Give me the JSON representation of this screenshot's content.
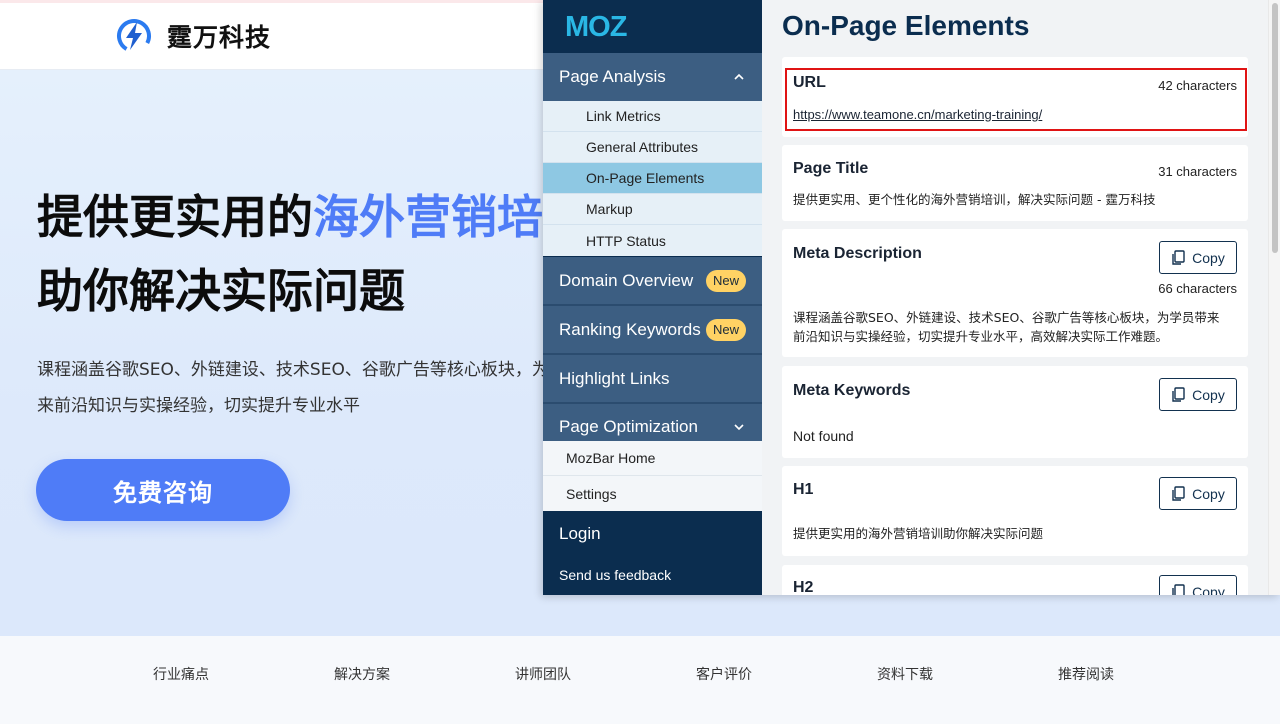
{
  "site": {
    "logo_text": "霆万科技",
    "hero_title_line1_plain": "提供更实用的",
    "hero_title_line1_highlight": "海外营销培训",
    "hero_title_line2": "助你解决实际问题",
    "hero_desc_line1": "课程涵盖谷歌SEO、外链建设、技术SEO、谷歌广告等核心板块，为学员带",
    "hero_desc_line2": "来前沿知识与实操经验，切实提升专业水平",
    "cta_label": "免费咨询",
    "bottom_nav": [
      "行业痛点",
      "解决方案",
      "讲师团队",
      "客户评价",
      "资料下载",
      "推荐阅读"
    ]
  },
  "mozbar": {
    "logo": "MOZ",
    "sidebar": {
      "page_analysis": "Page Analysis",
      "page_analysis_items": [
        "Link Metrics",
        "General Attributes",
        "On-Page Elements",
        "Markup",
        "HTTP Status"
      ],
      "domain_overview": "Domain Overview",
      "ranking_keywords": "Ranking Keywords",
      "new_badge": "New",
      "highlight_links": "Highlight Links",
      "page_optimization": "Page Optimization",
      "lower_items": [
        "MozBar Home",
        "Settings"
      ],
      "login": "Login",
      "feedback": "Send us feedback"
    },
    "main": {
      "title": "On-Page Elements",
      "copy_label": "Copy",
      "url": {
        "label": "URL",
        "count": "42 characters",
        "value": "https://www.teamone.cn/marketing-training/"
      },
      "page_title": {
        "label": "Page Title",
        "count": "31 characters",
        "value": "提供更实用、更个性化的海外营销培训，解决实际问题 - 霆万科技"
      },
      "meta_description": {
        "label": "Meta Description",
        "count": "66 characters",
        "value_line1": "课程涵盖谷歌SEO、外链建设、技术SEO、谷歌广告等核心板块，为学员带来",
        "value_line2": "前沿知识与实操经验，切实提升专业水平，高效解决实际工作难题。"
      },
      "meta_keywords": {
        "label": "Meta Keywords",
        "value": "Not found"
      },
      "h1": {
        "label": "H1",
        "value": "提供更实用的海外营销培训助你解决实际问题"
      },
      "h2": {
        "label": "H2"
      }
    }
  },
  "colors": {
    "accent_blue": "#4f7cf7",
    "moz_navy": "#0b2d4f",
    "moz_section": "#3c5e82",
    "active_item": "#8ec8e3",
    "badge": "#ffd264",
    "highlight_red": "#e01414"
  }
}
